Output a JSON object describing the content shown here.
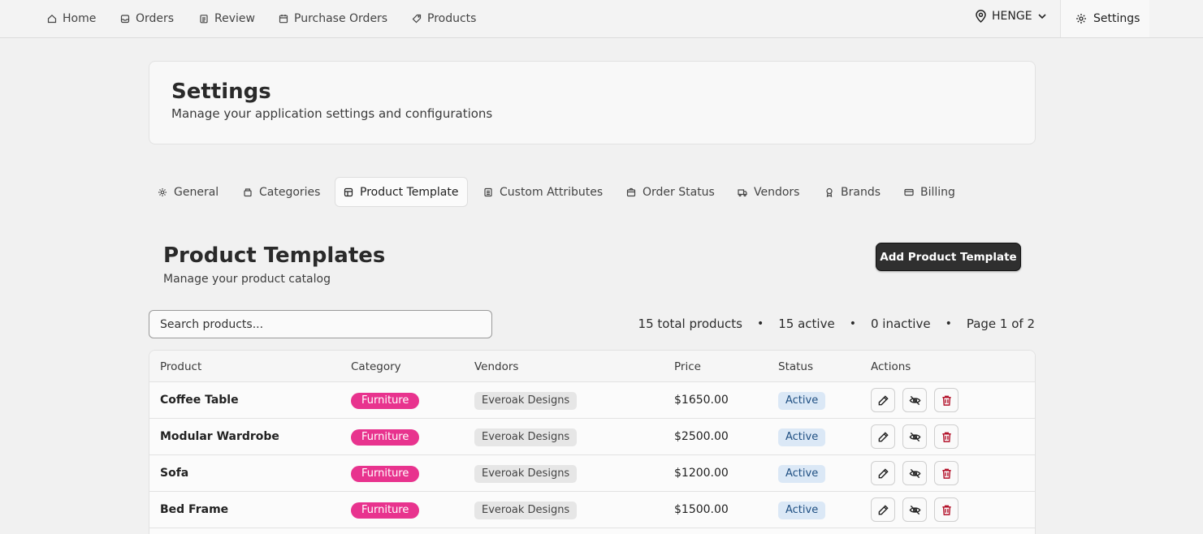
{
  "nav": {
    "items": [
      {
        "label": "Home",
        "icon": "home-icon"
      },
      {
        "label": "Orders",
        "icon": "inbox-icon"
      },
      {
        "label": "Review",
        "icon": "clipboard-icon"
      },
      {
        "label": "Purchase Orders",
        "icon": "calendar-icon"
      },
      {
        "label": "Products",
        "icon": "tag-icon"
      }
    ],
    "location": "HENGE",
    "settings_label": "Settings"
  },
  "header": {
    "title": "Settings",
    "subtitle": "Manage your application settings and configurations"
  },
  "tabs": [
    {
      "label": "General",
      "icon": "gear-icon"
    },
    {
      "label": "Categories",
      "icon": "box-icon"
    },
    {
      "label": "Product Template",
      "icon": "template-icon",
      "active": true
    },
    {
      "label": "Custom Attributes",
      "icon": "list-icon"
    },
    {
      "label": "Order Status",
      "icon": "package-icon"
    },
    {
      "label": "Vendors",
      "icon": "truck-icon"
    },
    {
      "label": "Brands",
      "icon": "award-icon"
    },
    {
      "label": "Billing",
      "icon": "card-icon"
    }
  ],
  "section": {
    "title": "Product Templates",
    "subtitle": "Manage your product catalog",
    "add_button": "Add Product Template"
  },
  "search": {
    "placeholder": "Search products..."
  },
  "stats": {
    "total": "15 total products",
    "active": "15 active",
    "inactive": "0 inactive",
    "page": "Page 1 of 2",
    "separator": "•"
  },
  "table": {
    "headers": {
      "product": "Product",
      "category": "Category",
      "vendors": "Vendors",
      "price": "Price",
      "status": "Status",
      "actions": "Actions"
    },
    "rows": [
      {
        "product": "Coffee Table",
        "category": "Furniture",
        "vendor": "Everoak Designs",
        "price": "$1650.00",
        "status": "Active"
      },
      {
        "product": "Modular Wardrobe",
        "category": "Furniture",
        "vendor": "Everoak Designs",
        "price": "$2500.00",
        "status": "Active"
      },
      {
        "product": "Sofa",
        "category": "Furniture",
        "vendor": "Everoak Designs",
        "price": "$1200.00",
        "status": "Active"
      },
      {
        "product": "Bed Frame",
        "category": "Furniture",
        "vendor": "Everoak Designs",
        "price": "$1500.00",
        "status": "Active"
      }
    ]
  },
  "colors": {
    "category_badge": "#e8338e",
    "status_badge_bg": "#dbe8f6",
    "delete_icon": "#b3122a",
    "primary_button": "#2f2f2f"
  }
}
